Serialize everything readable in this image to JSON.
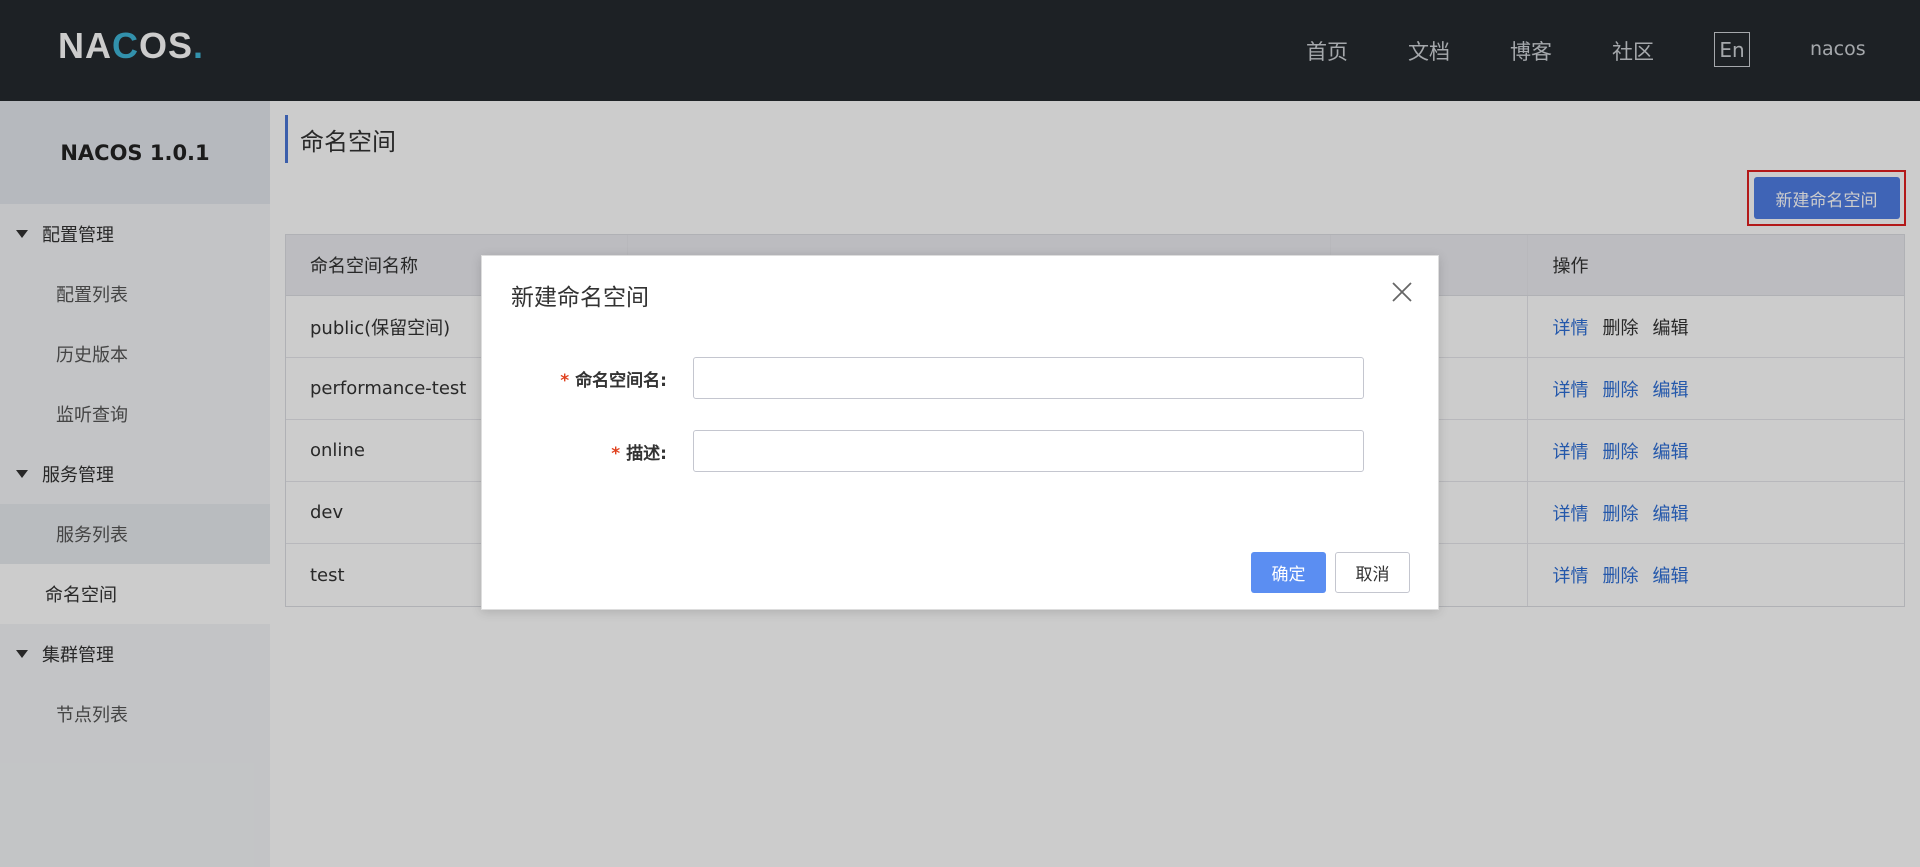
{
  "header": {
    "logo_text": "NACOS.",
    "nav": [
      "首页",
      "文档",
      "博客",
      "社区"
    ],
    "lang_button": "En",
    "user": "nacos"
  },
  "sidebar": {
    "version": "NACOS 1.0.1",
    "groups": [
      {
        "label": "配置管理",
        "items": [
          "配置列表",
          "历史版本",
          "监听查询"
        ]
      },
      {
        "label": "服务管理",
        "items": [
          "服务列表"
        ]
      },
      {
        "label": "命名空间",
        "items": []
      },
      {
        "label": "集群管理",
        "items": [
          "节点列表"
        ]
      }
    ]
  },
  "main": {
    "title": "命名空间",
    "new_button": "新建命名空间",
    "table": {
      "headers": [
        "命名空间名称",
        "",
        "",
        "操作"
      ],
      "rows": [
        {
          "name": "public(保留空间)"
        },
        {
          "name": "performance-test"
        },
        {
          "name": "online"
        },
        {
          "name": "dev"
        },
        {
          "name": "test"
        }
      ],
      "actions": {
        "detail": "详情",
        "delete": "删除",
        "edit": "编辑"
      }
    }
  },
  "modal": {
    "title": "新建命名空间",
    "fields": [
      {
        "label": "命名空间名:",
        "value": "",
        "required": true
      },
      {
        "label": "描述:",
        "value": "",
        "required": true
      }
    ],
    "required_mark": "*",
    "ok": "确定",
    "cancel": "取消"
  },
  "colors": {
    "topbar": "#252a2f",
    "primary": "#4f7de4",
    "link": "#2e6ed6",
    "highlight_border": "#e02020"
  }
}
